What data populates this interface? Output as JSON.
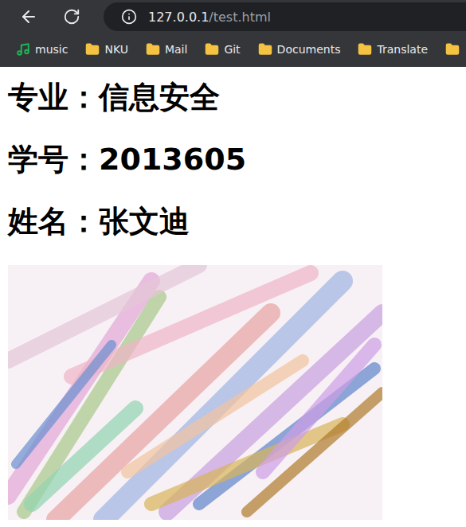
{
  "browser": {
    "address": {
      "host": "127.0.0.1",
      "path": "/test.html"
    }
  },
  "bookmarks": [
    {
      "label": "music",
      "kind": "music"
    },
    {
      "label": "NKU",
      "kind": "folder"
    },
    {
      "label": "Mail",
      "kind": "folder"
    },
    {
      "label": "Git",
      "kind": "folder"
    },
    {
      "label": "Documents",
      "kind": "folder"
    },
    {
      "label": "Translate",
      "kind": "folder"
    }
  ],
  "page": {
    "headings": [
      "专业：信息安全",
      "学号：2013605",
      "姓名：张文迪"
    ]
  }
}
